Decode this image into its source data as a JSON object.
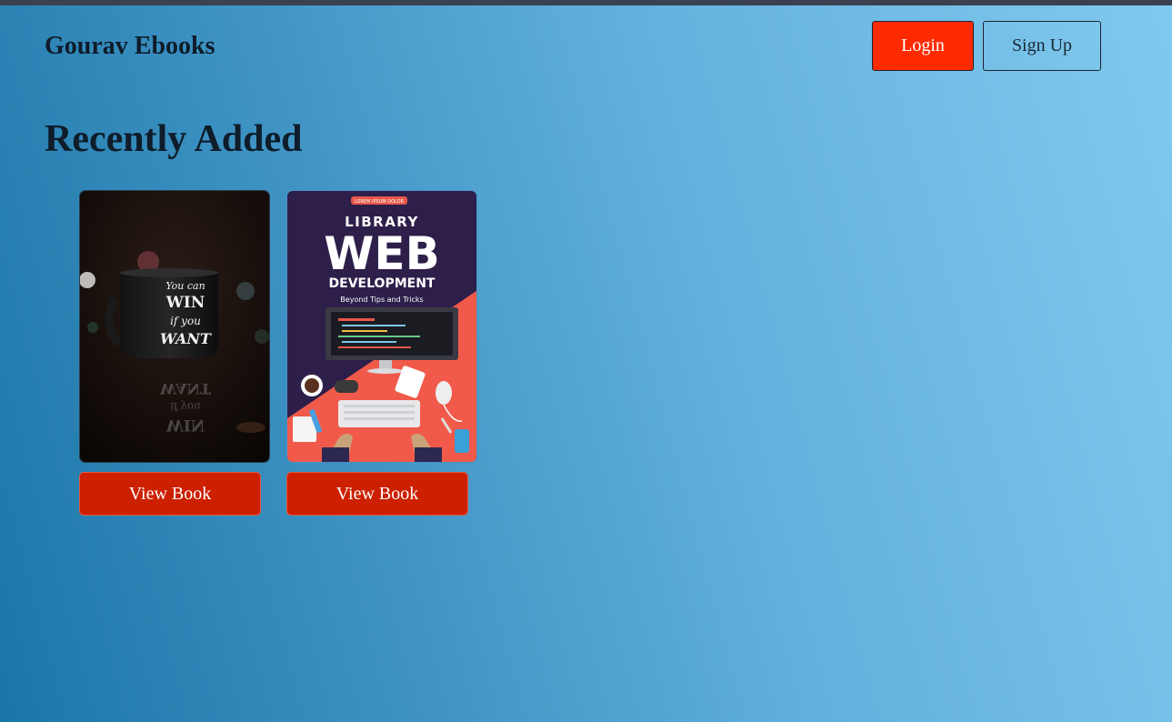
{
  "header": {
    "brand": "Gourav Ebooks",
    "login_label": "Login",
    "signup_label": "Sign Up"
  },
  "main": {
    "section_title": "Recently Added",
    "books": [
      {
        "cover_text": [
          "You can",
          "WIN",
          "if you",
          "WANT"
        ],
        "cover_reflection": [
          "WANT",
          "if you",
          "WIN"
        ],
        "button_label": "View Book"
      },
      {
        "cover_text": {
          "badge": "LOREM IPSUM DOLOR",
          "line1": "LIBRARY",
          "line2": "WEB",
          "line3": "DEVELOPMENT",
          "line4": "Beyond Tips and Tricks"
        },
        "button_label": "View Book"
      }
    ]
  },
  "colors": {
    "login_bg": "#ff2a00",
    "view_button_bg": "#cc2000",
    "text_dark": "#0f1c2a"
  }
}
